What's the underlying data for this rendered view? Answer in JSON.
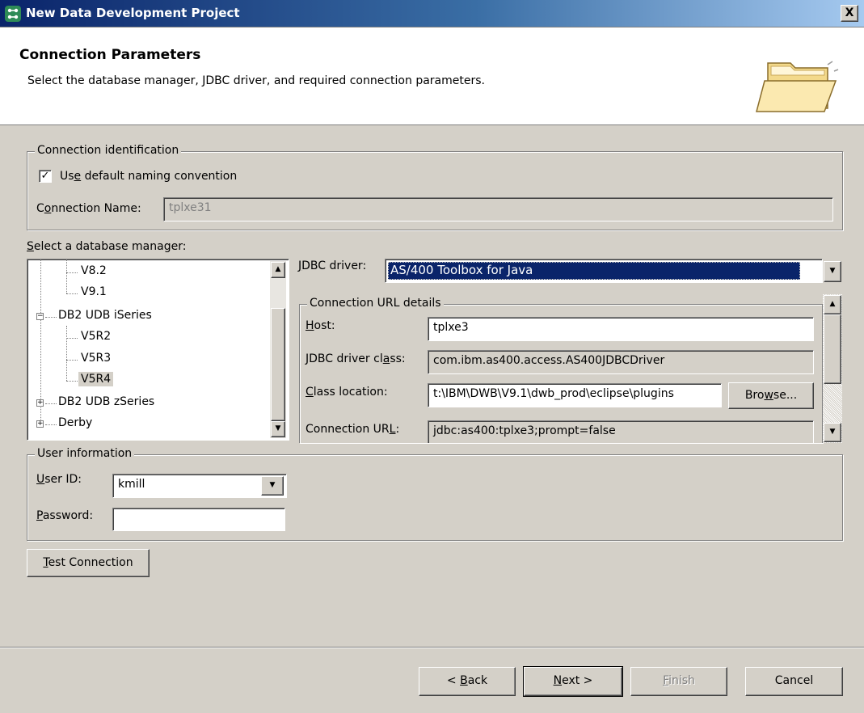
{
  "window": {
    "title": "New Data Development Project",
    "close_label": "X"
  },
  "header": {
    "heading": "Connection Parameters",
    "description": "Select the database manager, JDBC driver, and required connection parameters."
  },
  "connection_identification": {
    "legend": "Connection identification",
    "use_default_label_pre": "Us",
    "use_default_label_key": "e",
    "use_default_label_post": " default naming convention",
    "use_default_checked": true,
    "check_mark": "✓",
    "connection_name_label_pre": "C",
    "connection_name_label_key": "o",
    "connection_name_label_post": "nnection Name:",
    "connection_name_value": "tplxe31"
  },
  "db_manager": {
    "label_key": "S",
    "label_post": "elect a database manager:",
    "tree": [
      {
        "label": "V8.2",
        "level": 2
      },
      {
        "label": "V9.1",
        "level": 2
      },
      {
        "label": "DB2 UDB iSeries",
        "level": 1,
        "expander": "−"
      },
      {
        "label": "V5R2",
        "level": 2
      },
      {
        "label": "V5R3",
        "level": 2
      },
      {
        "label": "V5R4",
        "level": 2,
        "selected": true
      },
      {
        "label": "DB2 UDB zSeries",
        "level": 1,
        "expander": "+"
      },
      {
        "label": "Derby",
        "level": 1,
        "expander": "+"
      }
    ]
  },
  "jdbc": {
    "label_key": "J",
    "label_post": "DBC driver:",
    "value": "AS/400 Toolbox for Java"
  },
  "url_details": {
    "legend": "Connection URL details",
    "host_label_key": "H",
    "host_label_post": "ost:",
    "host_value": "tplxe3",
    "driver_class_label_pre": "JDBC driver cl",
    "driver_class_label_key": "a",
    "driver_class_label_post": "ss:",
    "driver_class_value": "com.ibm.as400.access.AS400JDBCDriver",
    "class_location_label_key": "C",
    "class_location_label_post": "lass location:",
    "class_location_value": "t:\\IBM\\DWB\\V9.1\\dwb_prod\\eclipse\\plugins",
    "browse_pre": "Bro",
    "browse_key": "w",
    "browse_post": "se...",
    "url_label_pre": "Connection UR",
    "url_label_key": "L",
    "url_label_post": ":",
    "url_value": "jdbc:as400:tplxe3;prompt=false"
  },
  "user_info": {
    "legend": "User information",
    "user_id_label_key": "U",
    "user_id_label_post": "ser ID:",
    "user_id_value": "kmill",
    "password_label_key": "P",
    "password_label_post": "assword:",
    "password_value": ""
  },
  "test_connection": {
    "label_key": "T",
    "label_post": "est Connection"
  },
  "footer": {
    "back_pre": "< ",
    "back_key": "B",
    "back_post": "ack",
    "next_key": "N",
    "next_post": "ext >",
    "finish_key": "F",
    "finish_post": "inish",
    "cancel": "Cancel"
  }
}
